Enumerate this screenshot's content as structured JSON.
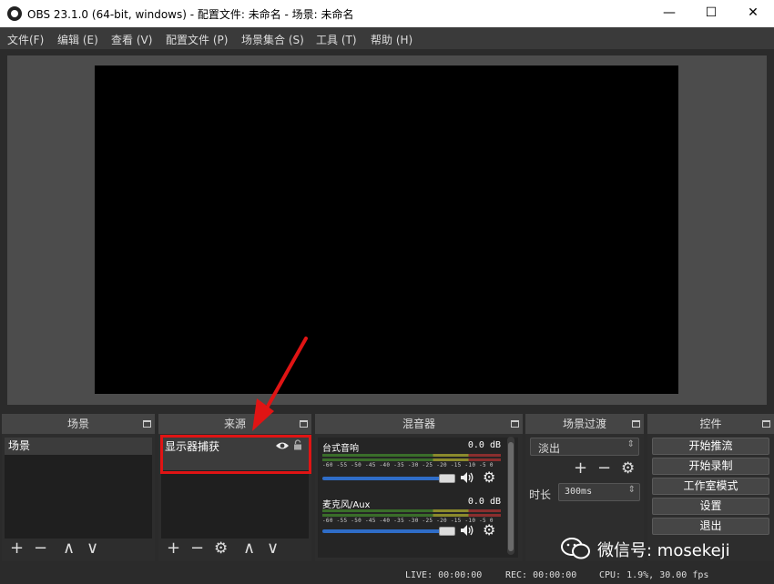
{
  "window": {
    "title": "OBS 23.1.0 (64-bit, windows) - 配置文件: 未命名 - 场景: 未命名",
    "minimize": "—",
    "maximize": "☐",
    "close": "✕"
  },
  "menu": [
    "文件(F)",
    "编辑 (E)",
    "查看 (V)",
    "配置文件 (P)",
    "场景集合 (S)",
    "工具 (T)",
    "帮助 (H)"
  ],
  "docks": {
    "scenes": {
      "title": "场景",
      "items": [
        "场景"
      ]
    },
    "sources": {
      "title": "来源",
      "items": [
        "显示器捕获"
      ]
    },
    "mixer": {
      "title": "混音器"
    },
    "transitions": {
      "title": "场景过渡",
      "selected": "淡出",
      "duration_label": "时长",
      "duration_value": "300ms"
    },
    "controls": {
      "title": "控件",
      "buttons": [
        "开始推流",
        "开始录制",
        "工作室模式",
        "设置",
        "退出"
      ]
    }
  },
  "mixer": {
    "channels": [
      {
        "name": "台式音响",
        "db": "0.0 dB"
      },
      {
        "name": "麦克风/Aux",
        "db": "0.0 dB"
      }
    ],
    "ticks": "-60 -55 -50 -45 -40 -35 -30 -25 -20 -15 -10 -5  0"
  },
  "toolbar": {
    "add": "+",
    "remove": "−",
    "up": "∧",
    "down": "∨",
    "gear": "⚙"
  },
  "icons": {
    "eye": "eye-icon",
    "lock": "lock-icon",
    "speaker": "speaker-icon",
    "gear": "gear-icon",
    "wechat": "wechat-icon"
  },
  "status": {
    "live": "LIVE: 00:00:00",
    "rec": "REC: 00:00:00",
    "cpu": "CPU: 1.9%, 30.00 fps"
  },
  "watermark": "微信号: mosekeji",
  "colors": {
    "highlight": "#e01414",
    "volume": "#2f6dc8",
    "arrow": "#e01414"
  }
}
